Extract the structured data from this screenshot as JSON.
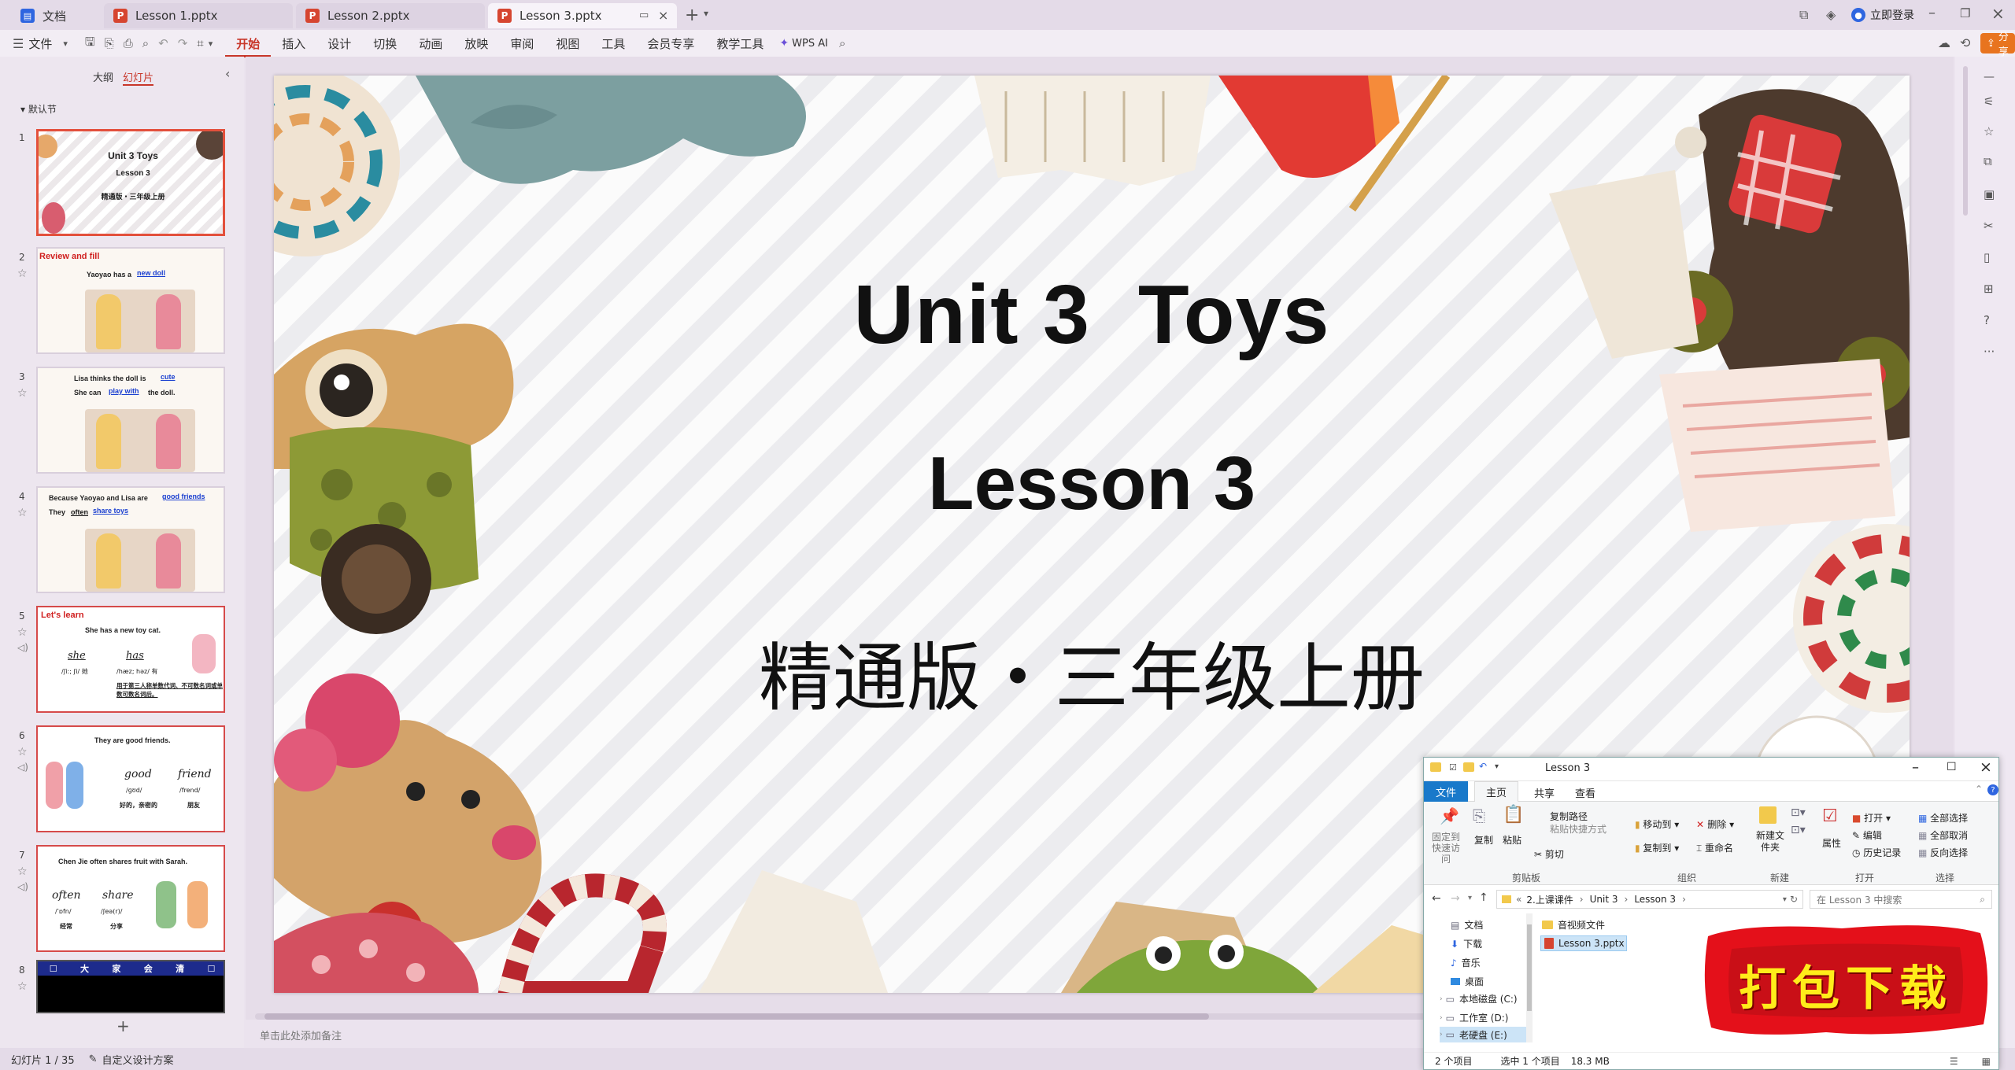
{
  "tabs": [
    {
      "label": "文档",
      "type": "doc"
    },
    {
      "label": "Lesson 1.pptx",
      "type": "ppt"
    },
    {
      "label": "Lesson 2.pptx",
      "type": "ppt"
    },
    {
      "label": "Lesson 3.pptx",
      "type": "ppt",
      "active": true
    }
  ],
  "titlebar": {
    "login": "立即登录",
    "share": "分享"
  },
  "menu": {
    "file": "文件",
    "items": [
      "开始",
      "插入",
      "设计",
      "切换",
      "动画",
      "放映",
      "审阅",
      "视图",
      "工具",
      "会员专享",
      "教学工具"
    ],
    "active": "开始",
    "wps_ai": "WPS AI"
  },
  "leftpanel": {
    "tab_outline": "大纲",
    "tab_slides": "幻灯片",
    "section": "默认节",
    "add_icon": "+"
  },
  "thumbs": [
    {
      "num": "1",
      "l1": "Unit 3  Toys",
      "l2": "Lesson 3",
      "l3": "精通版・三年级上册"
    },
    {
      "num": "2",
      "head": "Review and fill",
      "text": "Yaoyao has a",
      "blank": "new doll"
    },
    {
      "num": "3",
      "text": "Lisa thinks the doll is",
      "blank": "cute",
      "text2": "She can",
      "blank2": "play with",
      "text3": "the doll."
    },
    {
      "num": "4",
      "text": "Because Yaoyao and Lisa are",
      "blank": "good friends",
      "text2": "They",
      "blank2": "often",
      "blank3": "share toys"
    },
    {
      "num": "5",
      "head": "Let's learn",
      "text": "She has a new toy cat.",
      "w1": "she",
      "w2": "has",
      "p1": "/ʃiː; ʃi/ 她",
      "p2": "/hæz; həz/ 有",
      "note": "用于第三人称单数代词、不可数名词或单数可数名词后。"
    },
    {
      "num": "6",
      "text": "They are good friends.",
      "w1": "good",
      "w2": "friend",
      "p1": "/ɡʊd/",
      "p2": "/frend/",
      "m1": "好的，亲密的",
      "m2": "朋友"
    },
    {
      "num": "7",
      "text": "Chen Jie often shares fruit with Sarah.",
      "w1": "often",
      "w2": "share",
      "p1": "/ˈɒfn/",
      "p2": "/ʃeə(r)/",
      "m1": "经常",
      "m2": "分享"
    },
    {
      "num": "8",
      "chars": [
        "大",
        "家",
        "会",
        "清"
      ]
    }
  ],
  "slide": {
    "title": "Unit 3  Toys",
    "subtitle": "Lesson 3",
    "edition": "精通版・三年级上册"
  },
  "notes_placeholder": "单击此处添加备注",
  "status": {
    "slide_count": "幻灯片 1 / 35",
    "design": "自定义设计方案"
  },
  "explorer": {
    "title": "Lesson 3",
    "ribbon_tabs": [
      "文件",
      "主页",
      "共享",
      "查看"
    ],
    "ribbon": {
      "pin": "固定到快速访问",
      "copy": "复制",
      "paste": "粘贴",
      "copy_path": "复制路径",
      "paste_shortcut": "粘贴快捷方式",
      "cut": "剪切",
      "move_to": "移动到",
      "copy_to": "复制到",
      "delete": "删除",
      "rename": "重命名",
      "new_folder": "新建文件夹",
      "properties": "属性",
      "open": "打开",
      "edit": "编辑",
      "history": "历史记录",
      "select_all": "全部选择",
      "select_none": "全部取消",
      "invert": "反向选择",
      "groups": [
        "剪贴板",
        "组织",
        "新建",
        "打开",
        "选择"
      ]
    },
    "breadcrumb": [
      "2.上课课件",
      "Unit 3",
      "Lesson 3"
    ],
    "search_placeholder": "在 Lesson 3 中搜索",
    "nav": [
      "文档",
      "下载",
      "音乐",
      "桌面",
      "本地磁盘 (C:)",
      "工作室 (D:)",
      "老硬盘 (E:)"
    ],
    "files": [
      "音视频文件",
      "Lesson 3.pptx"
    ],
    "status": {
      "count": "2 个项目",
      "selected": "选中 1 个项目",
      "size": "18.3 MB"
    }
  },
  "download_banner": "打包下载"
}
